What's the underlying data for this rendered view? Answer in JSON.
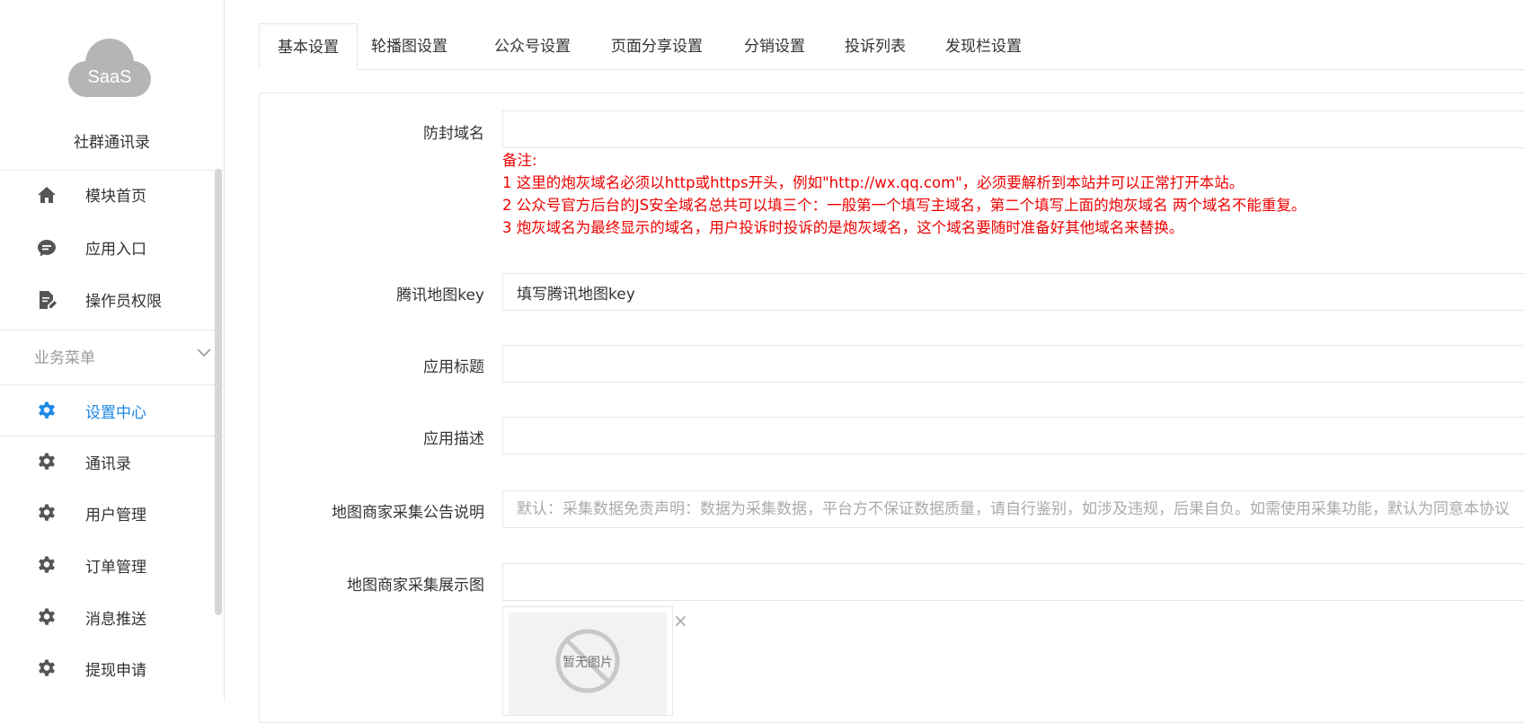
{
  "sidebar": {
    "logo_text": "SaaS",
    "app_name": "社群通讯录",
    "top_items": [
      {
        "label": "模块首页",
        "icon": "home-icon"
      },
      {
        "label": "应用入口",
        "icon": "chat-bubble-icon"
      },
      {
        "label": "操作员权限",
        "icon": "document-edit-icon"
      }
    ],
    "group_title": "业务菜单",
    "group_items": [
      {
        "label": "设置中心",
        "icon": "gear-icon",
        "active": true
      },
      {
        "label": "通讯录",
        "icon": "gear-icon"
      },
      {
        "label": "用户管理",
        "icon": "gear-icon"
      },
      {
        "label": "订单管理",
        "icon": "gear-icon"
      },
      {
        "label": "消息推送",
        "icon": "gear-icon"
      },
      {
        "label": "提现申请",
        "icon": "gear-icon"
      }
    ]
  },
  "tabs": [
    {
      "label": "基本设置",
      "active": true
    },
    {
      "label": "轮播图设置"
    },
    {
      "label": "公众号设置"
    },
    {
      "label": "页面分享设置"
    },
    {
      "label": "分销设置"
    },
    {
      "label": "投诉列表"
    },
    {
      "label": "发现栏设置"
    }
  ],
  "form": {
    "domain": {
      "label": "防封域名",
      "value": ""
    },
    "note": {
      "title": "备注:",
      "lines": [
        "1 这里的炮灰域名必须以http或https开头，例如\"http://wx.qq.com\"，必须要解析到本站并可以正常打开本站。",
        "2 公众号官方后台的JS安全域名总共可以填三个：一般第一个填写主域名，第二个填写上面的炮灰域名 两个域名不能重复。",
        "3 炮灰域名为最终显示的域名，用户投诉时投诉的是炮灰域名，这个域名要随时准备好其他域名来替换。"
      ]
    },
    "map_key": {
      "label": "腾讯地图key",
      "value": "填写腾讯地图key"
    },
    "app_title": {
      "label": "应用标题",
      "value": ""
    },
    "app_desc": {
      "label": "应用描述",
      "value": ""
    },
    "merchant_notice": {
      "label": "地图商家采集公告说明",
      "placeholder": "默认：采集数据免责声明：数据为采集数据，平台方不保证数据质量，请自行鉴别，如涉及违规，后果自负。如需使用采集功能，默认为同意本协议"
    },
    "merchant_image": {
      "label": "地图商家采集展示图",
      "value": "",
      "no_image_text": "暂无图片",
      "remove_glyph": "×"
    }
  },
  "colors": {
    "accent": "#1e88e5",
    "note_red": "#e00000",
    "icon_gray": "#555555"
  }
}
